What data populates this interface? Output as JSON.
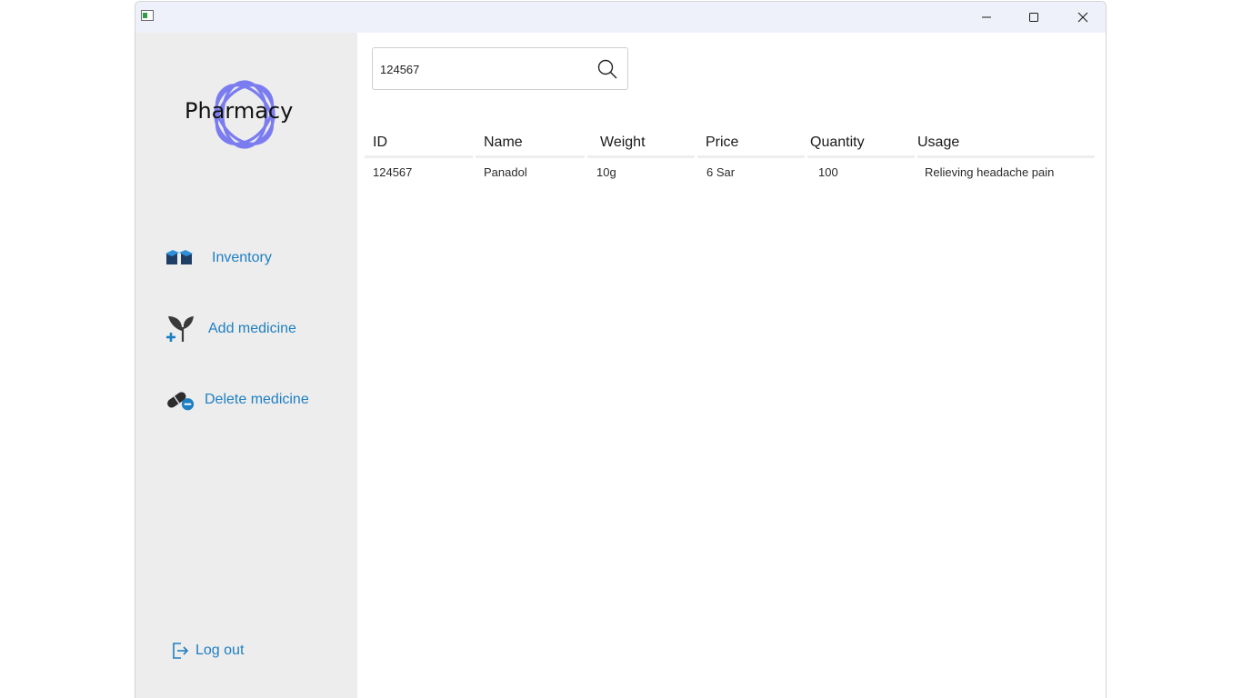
{
  "window": {
    "controls": {
      "minimize": "–",
      "maximize": "□",
      "close": "✕"
    }
  },
  "sidebar": {
    "logo_text": "Pharmacy",
    "nav": [
      {
        "label": "Inventory",
        "icon": "boxes-icon"
      },
      {
        "label": "Add medicine",
        "icon": "plant-add-icon"
      },
      {
        "label": "Delete medicine",
        "icon": "pills-remove-icon"
      }
    ],
    "logout_label": "Log out",
    "accent_color": "#1e7fc2"
  },
  "search": {
    "value": "124567"
  },
  "table": {
    "columns": [
      "ID",
      "Name",
      "Weight",
      "Price",
      "Quantity",
      "Usage"
    ],
    "rows": [
      [
        "124567",
        "Panadol",
        "10g",
        "6 Sar",
        "100",
        "Relieving headache pain"
      ]
    ]
  }
}
